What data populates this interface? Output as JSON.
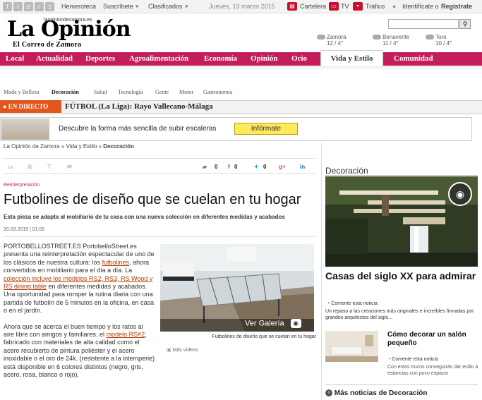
{
  "topbar": {
    "hemeroteca": "Hemeroteca",
    "suscribete": "Suscríbete",
    "clasificados": "Clasificados",
    "date": "Jueves, 19 marzo 2015",
    "cartelera": "Cartelera",
    "tv": "TV",
    "trafico": "Tráfico",
    "identificate": "Identifícate o",
    "registrate": "Registrate"
  },
  "header": {
    "logo": "La Opinión",
    "url": "laopiniondezamora.es",
    "subtitle": "El Correo de Zamora",
    "weather": [
      {
        "city": "Zamora",
        "temp": "12 / 4°"
      },
      {
        "city": "Benavente",
        "temp": "11 / 4°"
      },
      {
        "city": "Toro",
        "temp": "10 / 4°"
      }
    ]
  },
  "nav": {
    "items": [
      "Local",
      "Actualidad",
      "Deportes",
      "Agroalimentación",
      "Economía",
      "Opinión",
      "Ocio",
      "Vida y Estilo",
      "Comunidad"
    ]
  },
  "subnav": [
    "Moda y Belleza",
    "Decoración",
    "Salud",
    "Tecnología",
    "Gente",
    "Motor",
    "Gastronomía"
  ],
  "direct": {
    "badge": "EN DIRECTO",
    "text": "FÚTBOL (La Liga): Rayo Vallecano-Málaga"
  },
  "ad": {
    "text": "Descubre la forma más sencilla de subir escaleras",
    "button": "Infórmate"
  },
  "breadcrumb": {
    "home": "La Opinión de Zamora",
    "section": "Vida y Estilo",
    "current": "Decoración"
  },
  "share": {
    "count1": "0",
    "count2": "0",
    "count3": "0"
  },
  "article": {
    "kicker": "Reinterpretación",
    "title": "Futbolines de diseño que se cuelan en tu hogar",
    "subtitle": "Esta pieza se adapta al mobiliario de tu casa con una nueva colección en diferentes medidas y acabados",
    "date": "20.03.2015 | 01:00",
    "p1_lead": "PORTOBELLOSTREET.ES",
    "p1_a": " PortobelloStreet.es presenta una reinterpretación espectacular de uno de los clásicos de nuestra cultura: los ",
    "p1_link1": "futbolines",
    "p1_b": ", ahora convertidos en mobiliario para el día a día. La ",
    "p1_link2": "colección incluye los modelos RS2, RS3, RS Wood y RS dining table",
    "p1_c": " en diferentes medidas y acabados. Una oportunidad para romper la rutina diaria con una partida de futbolín de 5 minutos en la oficina, en casa o en el jardín.",
    "p2_a": "Ahora que se acerca el buen tiempo y los ratos al aire libre con amigos y familiares, el ",
    "p2_link": "modelo RS#2",
    "p2_b": ", fabricado con materiales de alta calidad como el acero recubierto de pintura poliéster y el acero inoxidable o el oro de 24k. (resistente a la intemperie) está disponible en 6 colores distintos (negro, gris, acero, rosa, blanco o rojo).",
    "gallery_label": "Ver Galería",
    "caption": "Futbolines de diseño que se cuelan en tu hogar",
    "more_videos": "Más vídeos"
  },
  "sidebar": {
    "section": "Decoración",
    "story1_title": "Casas del siglo XX para admirar",
    "story1_comment": "Comente esta noticia",
    "story1_desc": "Un repaso a las creaciones más originales e increíbles firmadas por grandes arquitectos del siglo...",
    "story2_title": "Cómo decorar un salón pequeño",
    "story2_comment": "Comente esta noticia",
    "story2_desc": "Con estos trucos conseguirás dar estilo a estancias con poco espacio",
    "more": "Más noticias de Decoración"
  },
  "colors": {
    "brand": "#c41e5a",
    "live": "#e3561b",
    "link": "#b43a00"
  }
}
